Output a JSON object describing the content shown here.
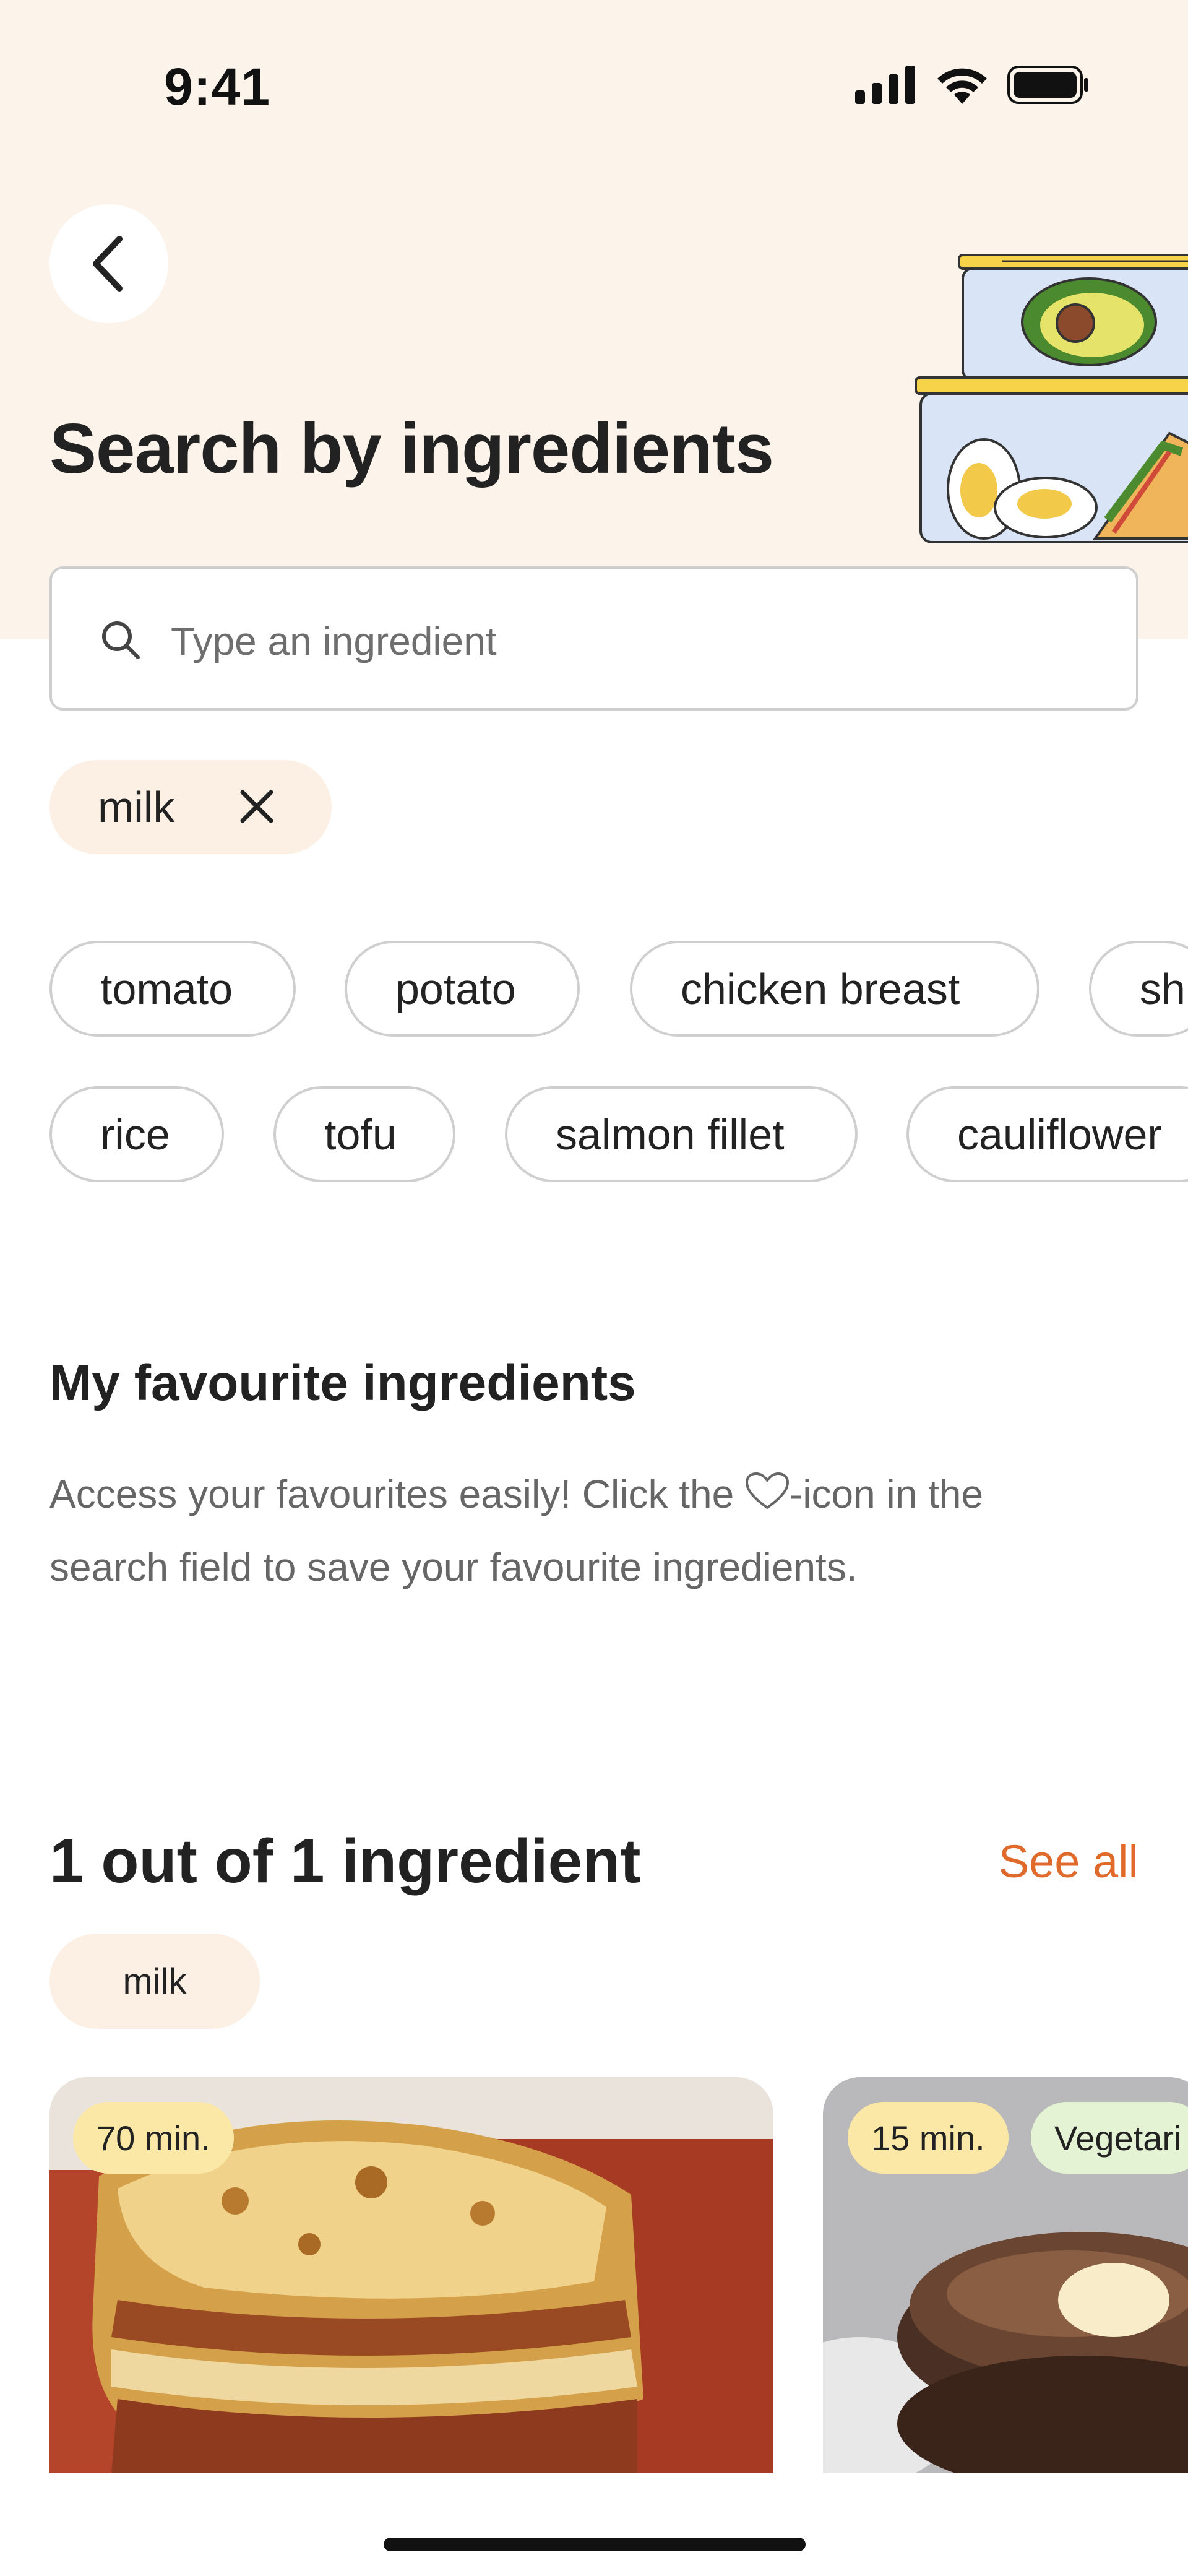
{
  "status_bar": {
    "time": "9:41"
  },
  "header": {
    "title": "Search by ingredients"
  },
  "search": {
    "placeholder": "Type an ingredient"
  },
  "selected_ingredients": [
    {
      "label": "milk"
    }
  ],
  "suggestions": {
    "row1": [
      "tomato",
      "potato",
      "chicken breast",
      "sh"
    ],
    "row2": [
      "rice",
      "tofu",
      "salmon fillet",
      "cauliflower"
    ]
  },
  "favourites": {
    "title": "My favourite ingredients",
    "desc_before": "Access your favourites easily! Click the ",
    "desc_after": "-icon in the search field to save your favourite ingredients."
  },
  "results": {
    "title": "1 out of 1 ingredient",
    "see_all": "See all",
    "ingredient_chip": "milk",
    "cards": [
      {
        "time": "70 min.",
        "diet": ""
      },
      {
        "time": "15 min.",
        "diet": "Vegetari"
      }
    ]
  },
  "colors": {
    "accent": "#e06a2c",
    "header_bg": "#fcf3ea",
    "chip_bg": "#fcf0e4"
  }
}
